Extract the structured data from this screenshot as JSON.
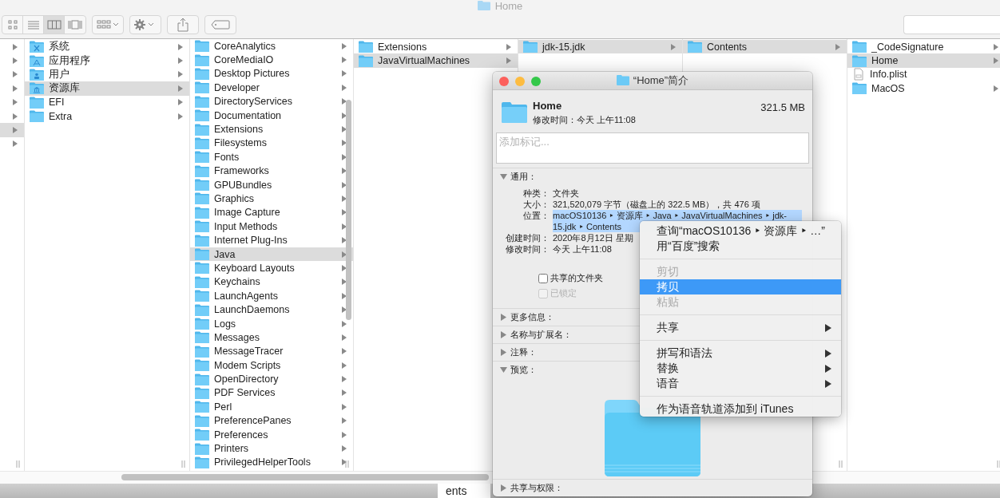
{
  "window": {
    "title": "Home"
  },
  "toolbar": {
    "view_buttons": [
      {
        "kind": "icons",
        "selected": false
      },
      {
        "kind": "list",
        "selected": false
      },
      {
        "kind": "columns",
        "selected": true
      },
      {
        "kind": "gallery",
        "selected": false
      }
    ]
  },
  "columns": [
    {
      "offset": false,
      "items": [
        {
          "selected": false,
          "arrow": true
        },
        {
          "selected": false,
          "arrow": true
        },
        {
          "selected": false,
          "arrow": true
        },
        {
          "selected": false,
          "arrow": true
        },
        {
          "selected": false,
          "arrow": true
        },
        {
          "selected": false,
          "arrow": true
        },
        {
          "selected": true,
          "arrow": true
        },
        {
          "selected": false,
          "arrow": true
        }
      ]
    },
    {
      "offset": false,
      "items": [
        {
          "name": "系统",
          "kind": "system",
          "selected": false,
          "arrow": true
        },
        {
          "name": "应用程序",
          "kind": "apps",
          "selected": false,
          "arrow": true
        },
        {
          "name": "用户",
          "kind": "users",
          "selected": false,
          "arrow": true
        },
        {
          "name": "资源库",
          "kind": "library",
          "selected": true,
          "arrow": true
        },
        {
          "name": "EFI",
          "kind": "folder",
          "selected": false,
          "arrow": true
        },
        {
          "name": "Extra",
          "kind": "folder",
          "selected": false,
          "arrow": true
        }
      ]
    },
    {
      "offset": true,
      "items": [
        {
          "name": "CoreAnalytics",
          "kind": "folder",
          "selected": false,
          "arrow": true
        },
        {
          "name": "CoreMediaIO",
          "kind": "folder",
          "selected": false,
          "arrow": true
        },
        {
          "name": "Desktop Pictures",
          "kind": "folder",
          "selected": false,
          "arrow": true
        },
        {
          "name": "Developer",
          "kind": "folder",
          "selected": false,
          "arrow": true
        },
        {
          "name": "DirectoryServices",
          "kind": "folder",
          "selected": false,
          "arrow": true
        },
        {
          "name": "Documentation",
          "kind": "folder",
          "selected": false,
          "arrow": true
        },
        {
          "name": "Extensions",
          "kind": "folder",
          "selected": false,
          "arrow": true
        },
        {
          "name": "Filesystems",
          "kind": "folder",
          "selected": false,
          "arrow": true
        },
        {
          "name": "Fonts",
          "kind": "folder",
          "selected": false,
          "arrow": true
        },
        {
          "name": "Frameworks",
          "kind": "folder",
          "selected": false,
          "arrow": true
        },
        {
          "name": "GPUBundles",
          "kind": "folder",
          "selected": false,
          "arrow": true
        },
        {
          "name": "Graphics",
          "kind": "folder",
          "selected": false,
          "arrow": true
        },
        {
          "name": "Image Capture",
          "kind": "folder",
          "selected": false,
          "arrow": true
        },
        {
          "name": "Input Methods",
          "kind": "folder",
          "selected": false,
          "arrow": true
        },
        {
          "name": "Internet Plug-Ins",
          "kind": "folder",
          "selected": false,
          "arrow": true
        },
        {
          "name": "Java",
          "kind": "folder",
          "selected": true,
          "arrow": true
        },
        {
          "name": "Keyboard Layouts",
          "kind": "folder",
          "selected": false,
          "arrow": true
        },
        {
          "name": "Keychains",
          "kind": "folder",
          "selected": false,
          "arrow": true
        },
        {
          "name": "LaunchAgents",
          "kind": "folder",
          "selected": false,
          "arrow": true
        },
        {
          "name": "LaunchDaemons",
          "kind": "folder",
          "selected": false,
          "arrow": true
        },
        {
          "name": "Logs",
          "kind": "folder",
          "selected": false,
          "arrow": true
        },
        {
          "name": "Messages",
          "kind": "folder",
          "selected": false,
          "arrow": true
        },
        {
          "name": "MessageTracer",
          "kind": "folder",
          "selected": false,
          "arrow": true
        },
        {
          "name": "Modem Scripts",
          "kind": "folder",
          "selected": false,
          "arrow": true
        },
        {
          "name": "OpenDirectory",
          "kind": "folder",
          "selected": false,
          "arrow": true
        },
        {
          "name": "PDF Services",
          "kind": "folder",
          "selected": false,
          "arrow": true
        },
        {
          "name": "Perl",
          "kind": "folder",
          "selected": false,
          "arrow": true
        },
        {
          "name": "PreferencePanes",
          "kind": "folder",
          "selected": false,
          "arrow": true
        },
        {
          "name": "Preferences",
          "kind": "folder",
          "selected": false,
          "arrow": true
        },
        {
          "name": "Printers",
          "kind": "folder",
          "selected": false,
          "arrow": true
        },
        {
          "name": "PrivilegedHelperTools",
          "kind": "folder",
          "selected": false,
          "arrow": true
        }
      ]
    },
    {
      "offset": false,
      "items": [
        {
          "name": "Extensions",
          "kind": "folder",
          "selected": false,
          "arrow": true
        },
        {
          "name": "JavaVirtualMachines",
          "kind": "folder",
          "selected": true,
          "arrow": true
        }
      ]
    },
    {
      "offset": false,
      "items": [
        {
          "name": "jdk-15.jdk",
          "kind": "folder",
          "selected": true,
          "arrow": true
        }
      ]
    },
    {
      "offset": false,
      "items": [
        {
          "name": "Contents",
          "kind": "folder",
          "selected": true,
          "arrow": true
        }
      ]
    },
    {
      "offset": false,
      "items": [
        {
          "name": "_CodeSignature",
          "kind": "folder",
          "selected": false,
          "arrow": true
        },
        {
          "name": "Home",
          "kind": "folder",
          "selected": true,
          "arrow": true
        },
        {
          "name": "Info.plist",
          "kind": "file",
          "selected": false,
          "arrow": false
        },
        {
          "name": "MacOS",
          "kind": "folder",
          "selected": false,
          "arrow": true
        }
      ]
    }
  ],
  "background_window": {
    "text": "ents"
  },
  "info_window": {
    "title": "“Home”简介",
    "name": "Home",
    "modified": "修改时间：今天 上午11:08",
    "size": "321.5 MB",
    "tags": {
      "placeholder": "添加标记..."
    },
    "sections": [
      {
        "title": "通用：",
        "kind": "general",
        "expanded": true,
        "rows": [
          {
            "label": "种类：",
            "value": "文件夹",
            "selected": false
          },
          {
            "label": "大小：",
            "value": "321,520,079 字节（磁盘上的 322.5 MB），共 476 项",
            "selected": false
          },
          {
            "label": "位置：",
            "value": "macOS10136 ‣ 资源库 ‣ Java ‣ JavaVirtualMachines ‣ jdk-15.jdk ‣ Contents",
            "selected": true
          },
          {
            "label": "创建时间：",
            "value": "2020年8月12日 星期",
            "selected": false
          },
          {
            "label": "修改时间：",
            "value": "今天 上午11:08",
            "selected": false
          }
        ],
        "checkboxes": [
          {
            "label": "共享的文件夹",
            "checked": false,
            "disabled": false
          },
          {
            "label": "已锁定",
            "checked": false,
            "disabled": true
          }
        ]
      },
      {
        "title": "更多信息：",
        "kind": "plain",
        "expanded": false
      },
      {
        "title": "名称与扩展名：",
        "kind": "plain",
        "expanded": false
      },
      {
        "title": "注释：",
        "kind": "plain",
        "expanded": false
      },
      {
        "title": "预览：",
        "kind": "preview",
        "expanded": true
      },
      {
        "title": "共享与权限：",
        "kind": "plain",
        "expanded": false
      }
    ]
  },
  "context_menu": {
    "groups": [
      {
        "items": [
          {
            "label": "查询“macOS10136 ‣ 资源库 ‣ …”",
            "disabled": false,
            "selected": false,
            "submenu": false
          },
          {
            "label": "用“百度”搜索",
            "disabled": false,
            "selected": false,
            "submenu": false
          }
        ]
      },
      {
        "items": [
          {
            "label": "剪切",
            "disabled": true,
            "selected": false,
            "submenu": false
          },
          {
            "label": "拷贝",
            "disabled": false,
            "selected": true,
            "submenu": false
          },
          {
            "label": "粘贴",
            "disabled": true,
            "selected": false,
            "submenu": false
          }
        ]
      },
      {
        "items": [
          {
            "label": "共享",
            "disabled": false,
            "selected": false,
            "submenu": true
          }
        ]
      },
      {
        "items": [
          {
            "label": "拼写和语法",
            "disabled": false,
            "selected": false,
            "submenu": true
          },
          {
            "label": "替换",
            "disabled": false,
            "selected": false,
            "submenu": true
          },
          {
            "label": "语音",
            "disabled": false,
            "selected": false,
            "submenu": true
          }
        ]
      },
      {
        "items": [
          {
            "label": "作为语音轨道添加到 iTunes",
            "disabled": false,
            "selected": false,
            "submenu": false
          }
        ]
      }
    ]
  }
}
